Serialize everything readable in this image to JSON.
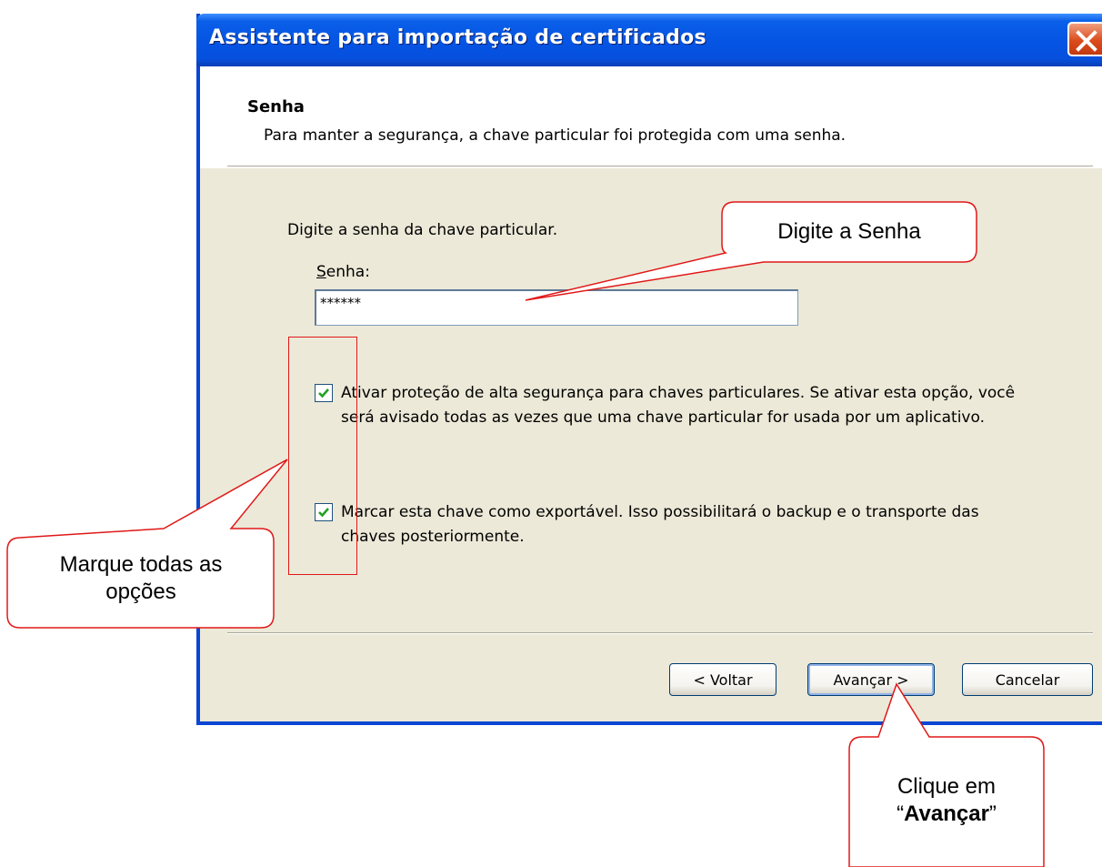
{
  "window": {
    "title": "Assistente para importação de certificados",
    "accent_color": "#0554e3",
    "close_icon": "close-icon"
  },
  "header": {
    "title": "Senha",
    "subtitle": "Para manter a segurança, a chave particular foi protegida com uma senha."
  },
  "body": {
    "prompt": "Digite a senha da chave particular.",
    "password_label": "Senha:",
    "password_value": "******",
    "options": [
      {
        "label": "Ativar proteção de alta segurança para chaves particulares. Se ativar esta opção, você será avisado todas as vezes que uma chave particular for usada por um aplicativo.",
        "checked": true
      },
      {
        "label": "Marcar esta chave como exportável. Isso possibilitará o backup e o transporte das chaves posteriormente.",
        "checked": true
      }
    ]
  },
  "buttons": {
    "back": "< Voltar",
    "next": "Avançar >",
    "cancel": "Cancelar"
  },
  "annotations": {
    "password_callout": "Digite a Senha",
    "options_callout_line1": "Marque todas as",
    "options_callout_line2": "opções",
    "next_callout_line1": "Clique em",
    "next_callout_quote_open": "“",
    "next_callout_bold": "Avançar",
    "next_callout_quote_close": "”",
    "annotation_color": "#e01818"
  }
}
